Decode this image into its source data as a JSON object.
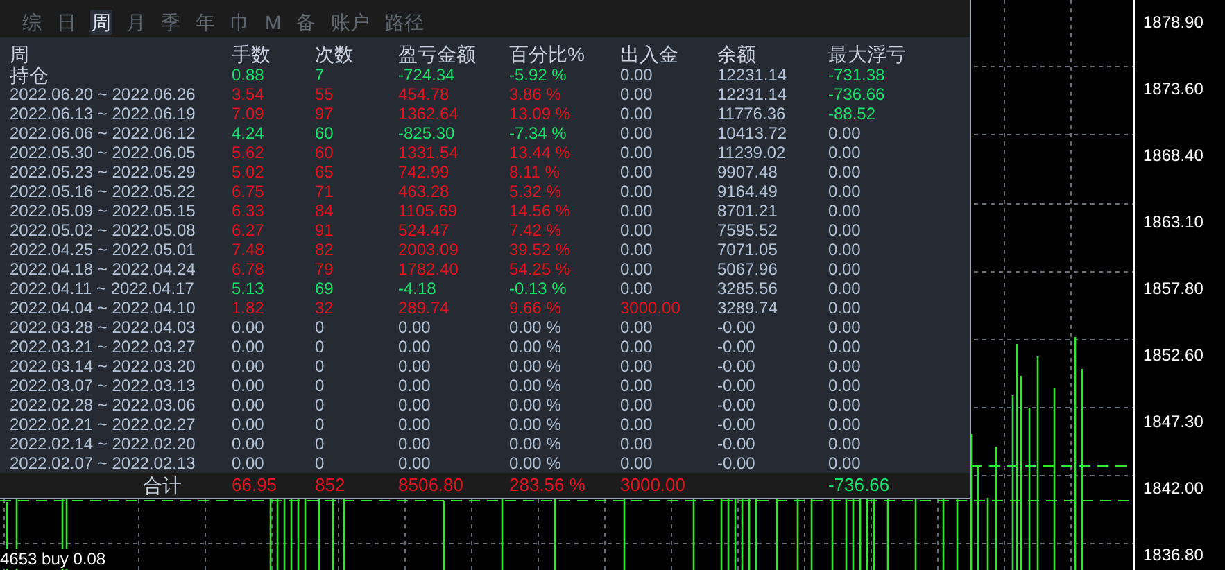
{
  "tabs": [
    {
      "label": "综",
      "selected": false
    },
    {
      "label": "日",
      "selected": false
    },
    {
      "label": "周",
      "selected": true
    },
    {
      "label": "月",
      "selected": false
    },
    {
      "label": "季",
      "selected": false
    },
    {
      "label": "年",
      "selected": false
    },
    {
      "label": "巾",
      "selected": false
    },
    {
      "label": "M",
      "selected": false
    },
    {
      "label": "备",
      "selected": false
    },
    {
      "label": "账户",
      "selected": false
    },
    {
      "label": "路径",
      "selected": false
    }
  ],
  "table": {
    "columns": [
      "周",
      "手数",
      "次数",
      "盈亏金额",
      "百分比%",
      "出入金",
      "余额",
      "最大浮亏"
    ],
    "rows": [
      {
        "cells": [
          {
            "text": "持仓"
          },
          {
            "text": "0.88",
            "color": "#19e36a"
          },
          {
            "text": "7",
            "color": "#19e36a"
          },
          {
            "text": "-724.34",
            "color": "#19e36a"
          },
          {
            "text": "-5.92 %",
            "color": "#19e36a"
          },
          {
            "text": "0.00",
            "color": "#b4c3d8"
          },
          {
            "text": "12231.14",
            "color": "#b4c3d8"
          },
          {
            "text": "-731.38",
            "color": "#19e36a"
          }
        ]
      },
      {
        "cells": [
          {
            "text": "2022.06.20 ~ 2022.06.26"
          },
          {
            "text": "3.54",
            "color": "#e0141e"
          },
          {
            "text": "55",
            "color": "#e0141e"
          },
          {
            "text": "454.78",
            "color": "#e0141e"
          },
          {
            "text": "3.86 %",
            "color": "#e0141e"
          },
          {
            "text": "0.00",
            "color": "#b4c3d8"
          },
          {
            "text": "12231.14",
            "color": "#b4c3d8"
          },
          {
            "text": "-736.66",
            "color": "#19e36a"
          }
        ]
      },
      {
        "cells": [
          {
            "text": "2022.06.13 ~ 2022.06.19"
          },
          {
            "text": "7.09",
            "color": "#e0141e"
          },
          {
            "text": "97",
            "color": "#e0141e"
          },
          {
            "text": "1362.64",
            "color": "#e0141e"
          },
          {
            "text": "13.09 %",
            "color": "#e0141e"
          },
          {
            "text": "0.00",
            "color": "#b4c3d8"
          },
          {
            "text": "11776.36",
            "color": "#b4c3d8"
          },
          {
            "text": "-88.52",
            "color": "#19e36a"
          }
        ]
      },
      {
        "cells": [
          {
            "text": "2022.06.06 ~ 2022.06.12"
          },
          {
            "text": "4.24",
            "color": "#19e36a"
          },
          {
            "text": "60",
            "color": "#19e36a"
          },
          {
            "text": "-825.30",
            "color": "#19e36a"
          },
          {
            "text": "-7.34 %",
            "color": "#19e36a"
          },
          {
            "text": "0.00",
            "color": "#b4c3d8"
          },
          {
            "text": "10413.72",
            "color": "#b4c3d8"
          },
          {
            "text": "0.00",
            "color": "#b4c3d8"
          }
        ]
      },
      {
        "cells": [
          {
            "text": "2022.05.30 ~ 2022.06.05"
          },
          {
            "text": "5.62",
            "color": "#e0141e"
          },
          {
            "text": "60",
            "color": "#e0141e"
          },
          {
            "text": "1331.54",
            "color": "#e0141e"
          },
          {
            "text": "13.44 %",
            "color": "#e0141e"
          },
          {
            "text": "0.00",
            "color": "#b4c3d8"
          },
          {
            "text": "11239.02",
            "color": "#b4c3d8"
          },
          {
            "text": "0.00",
            "color": "#b4c3d8"
          }
        ]
      },
      {
        "cells": [
          {
            "text": "2022.05.23 ~ 2022.05.29"
          },
          {
            "text": "5.02",
            "color": "#e0141e"
          },
          {
            "text": "65",
            "color": "#e0141e"
          },
          {
            "text": "742.99",
            "color": "#e0141e"
          },
          {
            "text": "8.11 %",
            "color": "#e0141e"
          },
          {
            "text": "0.00",
            "color": "#b4c3d8"
          },
          {
            "text": "9907.48",
            "color": "#b4c3d8"
          },
          {
            "text": "0.00",
            "color": "#b4c3d8"
          }
        ]
      },
      {
        "cells": [
          {
            "text": "2022.05.16 ~ 2022.05.22"
          },
          {
            "text": "6.75",
            "color": "#e0141e"
          },
          {
            "text": "71",
            "color": "#e0141e"
          },
          {
            "text": "463.28",
            "color": "#e0141e"
          },
          {
            "text": "5.32 %",
            "color": "#e0141e"
          },
          {
            "text": "0.00",
            "color": "#b4c3d8"
          },
          {
            "text": "9164.49",
            "color": "#b4c3d8"
          },
          {
            "text": "0.00",
            "color": "#b4c3d8"
          }
        ]
      },
      {
        "cells": [
          {
            "text": "2022.05.09 ~ 2022.05.15"
          },
          {
            "text": "6.33",
            "color": "#e0141e"
          },
          {
            "text": "84",
            "color": "#e0141e"
          },
          {
            "text": "1105.69",
            "color": "#e0141e"
          },
          {
            "text": "14.56 %",
            "color": "#e0141e"
          },
          {
            "text": "0.00",
            "color": "#b4c3d8"
          },
          {
            "text": "8701.21",
            "color": "#b4c3d8"
          },
          {
            "text": "0.00",
            "color": "#b4c3d8"
          }
        ]
      },
      {
        "cells": [
          {
            "text": "2022.05.02 ~ 2022.05.08"
          },
          {
            "text": "6.27",
            "color": "#e0141e"
          },
          {
            "text": "91",
            "color": "#e0141e"
          },
          {
            "text": "524.47",
            "color": "#e0141e"
          },
          {
            "text": "7.42 %",
            "color": "#e0141e"
          },
          {
            "text": "0.00",
            "color": "#b4c3d8"
          },
          {
            "text": "7595.52",
            "color": "#b4c3d8"
          },
          {
            "text": "0.00",
            "color": "#b4c3d8"
          }
        ]
      },
      {
        "cells": [
          {
            "text": "2022.04.25 ~ 2022.05.01"
          },
          {
            "text": "7.48",
            "color": "#e0141e"
          },
          {
            "text": "82",
            "color": "#e0141e"
          },
          {
            "text": "2003.09",
            "color": "#e0141e"
          },
          {
            "text": "39.52 %",
            "color": "#e0141e"
          },
          {
            "text": "0.00",
            "color": "#b4c3d8"
          },
          {
            "text": "7071.05",
            "color": "#b4c3d8"
          },
          {
            "text": "0.00",
            "color": "#b4c3d8"
          }
        ]
      },
      {
        "cells": [
          {
            "text": "2022.04.18 ~ 2022.04.24"
          },
          {
            "text": "6.78",
            "color": "#e0141e"
          },
          {
            "text": "79",
            "color": "#e0141e"
          },
          {
            "text": "1782.40",
            "color": "#e0141e"
          },
          {
            "text": "54.25 %",
            "color": "#e0141e"
          },
          {
            "text": "0.00",
            "color": "#b4c3d8"
          },
          {
            "text": "5067.96",
            "color": "#b4c3d8"
          },
          {
            "text": "0.00",
            "color": "#b4c3d8"
          }
        ]
      },
      {
        "cells": [
          {
            "text": "2022.04.11 ~ 2022.04.17"
          },
          {
            "text": "5.13",
            "color": "#19e36a"
          },
          {
            "text": "69",
            "color": "#19e36a"
          },
          {
            "text": "-4.18",
            "color": "#19e36a"
          },
          {
            "text": "-0.13 %",
            "color": "#19e36a"
          },
          {
            "text": "0.00",
            "color": "#b4c3d8"
          },
          {
            "text": "3285.56",
            "color": "#b4c3d8"
          },
          {
            "text": "0.00",
            "color": "#b4c3d8"
          }
        ]
      },
      {
        "cells": [
          {
            "text": "2022.04.04 ~ 2022.04.10"
          },
          {
            "text": "1.82",
            "color": "#e0141e"
          },
          {
            "text": "32",
            "color": "#e0141e"
          },
          {
            "text": "289.74",
            "color": "#e0141e"
          },
          {
            "text": "9.66 %",
            "color": "#e0141e"
          },
          {
            "text": "3000.00",
            "color": "#e0141e"
          },
          {
            "text": "3289.74",
            "color": "#b4c3d8"
          },
          {
            "text": "0.00",
            "color": "#b4c3d8"
          }
        ]
      },
      {
        "cells": [
          {
            "text": "2022.03.28 ~ 2022.04.03"
          },
          {
            "text": "0.00",
            "color": "#b4c3d8"
          },
          {
            "text": "0",
            "color": "#b4c3d8"
          },
          {
            "text": "0.00",
            "color": "#b4c3d8"
          },
          {
            "text": "0.00 %",
            "color": "#b4c3d8"
          },
          {
            "text": "0.00",
            "color": "#b4c3d8"
          },
          {
            "text": "-0.00",
            "color": "#b4c3d8"
          },
          {
            "text": "0.00",
            "color": "#b4c3d8"
          }
        ]
      },
      {
        "cells": [
          {
            "text": "2022.03.21 ~ 2022.03.27"
          },
          {
            "text": "0.00",
            "color": "#b4c3d8"
          },
          {
            "text": "0",
            "color": "#b4c3d8"
          },
          {
            "text": "0.00",
            "color": "#b4c3d8"
          },
          {
            "text": "0.00 %",
            "color": "#b4c3d8"
          },
          {
            "text": "0.00",
            "color": "#b4c3d8"
          },
          {
            "text": "-0.00",
            "color": "#b4c3d8"
          },
          {
            "text": "0.00",
            "color": "#b4c3d8"
          }
        ]
      },
      {
        "cells": [
          {
            "text": "2022.03.14 ~ 2022.03.20"
          },
          {
            "text": "0.00",
            "color": "#b4c3d8"
          },
          {
            "text": "0",
            "color": "#b4c3d8"
          },
          {
            "text": "0.00",
            "color": "#b4c3d8"
          },
          {
            "text": "0.00 %",
            "color": "#b4c3d8"
          },
          {
            "text": "0.00",
            "color": "#b4c3d8"
          },
          {
            "text": "-0.00",
            "color": "#b4c3d8"
          },
          {
            "text": "0.00",
            "color": "#b4c3d8"
          }
        ]
      },
      {
        "cells": [
          {
            "text": "2022.03.07 ~ 2022.03.13"
          },
          {
            "text": "0.00",
            "color": "#b4c3d8"
          },
          {
            "text": "0",
            "color": "#b4c3d8"
          },
          {
            "text": "0.00",
            "color": "#b4c3d8"
          },
          {
            "text": "0.00 %",
            "color": "#b4c3d8"
          },
          {
            "text": "0.00",
            "color": "#b4c3d8"
          },
          {
            "text": "-0.00",
            "color": "#b4c3d8"
          },
          {
            "text": "0.00",
            "color": "#b4c3d8"
          }
        ]
      },
      {
        "cells": [
          {
            "text": "2022.02.28 ~ 2022.03.06"
          },
          {
            "text": "0.00",
            "color": "#b4c3d8"
          },
          {
            "text": "0",
            "color": "#b4c3d8"
          },
          {
            "text": "0.00",
            "color": "#b4c3d8"
          },
          {
            "text": "0.00 %",
            "color": "#b4c3d8"
          },
          {
            "text": "0.00",
            "color": "#b4c3d8"
          },
          {
            "text": "-0.00",
            "color": "#b4c3d8"
          },
          {
            "text": "0.00",
            "color": "#b4c3d8"
          }
        ]
      },
      {
        "cells": [
          {
            "text": "2022.02.21 ~ 2022.02.27"
          },
          {
            "text": "0.00",
            "color": "#b4c3d8"
          },
          {
            "text": "0",
            "color": "#b4c3d8"
          },
          {
            "text": "0.00",
            "color": "#b4c3d8"
          },
          {
            "text": "0.00 %",
            "color": "#b4c3d8"
          },
          {
            "text": "0.00",
            "color": "#b4c3d8"
          },
          {
            "text": "-0.00",
            "color": "#b4c3d8"
          },
          {
            "text": "0.00",
            "color": "#b4c3d8"
          }
        ]
      },
      {
        "cells": [
          {
            "text": "2022.02.14 ~ 2022.02.20"
          },
          {
            "text": "0.00",
            "color": "#b4c3d8"
          },
          {
            "text": "0",
            "color": "#b4c3d8"
          },
          {
            "text": "0.00",
            "color": "#b4c3d8"
          },
          {
            "text": "0.00 %",
            "color": "#b4c3d8"
          },
          {
            "text": "0.00",
            "color": "#b4c3d8"
          },
          {
            "text": "-0.00",
            "color": "#b4c3d8"
          },
          {
            "text": "0.00",
            "color": "#b4c3d8"
          }
        ]
      },
      {
        "cells": [
          {
            "text": "2022.02.07 ~ 2022.02.13"
          },
          {
            "text": "0.00",
            "color": "#b4c3d8"
          },
          {
            "text": "0",
            "color": "#b4c3d8"
          },
          {
            "text": "0.00",
            "color": "#b4c3d8"
          },
          {
            "text": "0.00 %",
            "color": "#b4c3d8"
          },
          {
            "text": "0.00",
            "color": "#b4c3d8"
          },
          {
            "text": "-0.00",
            "color": "#b4c3d8"
          },
          {
            "text": "0.00",
            "color": "#b4c3d8"
          }
        ]
      }
    ],
    "total": {
      "label": "合计",
      "lots": {
        "text": "66.95",
        "color": "#e0141e"
      },
      "trades": {
        "text": "852",
        "color": "#e0141e"
      },
      "pnl": {
        "text": "8506.80",
        "color": "#e0141e"
      },
      "percent": {
        "text": "283.56 %",
        "color": "#e0141e"
      },
      "deposit": {
        "text": "3000.00",
        "color": "#e0141e"
      },
      "max_drawdown": {
        "text": "-736.66",
        "color": "#19e36a"
      }
    }
  },
  "price_axis": [
    "1878.90",
    "1873.60",
    "1868.40",
    "1863.10",
    "1857.80",
    "1852.60",
    "1847.30",
    "1842.00",
    "1836.80"
  ],
  "chart_label": "4653 buy 0.08"
}
